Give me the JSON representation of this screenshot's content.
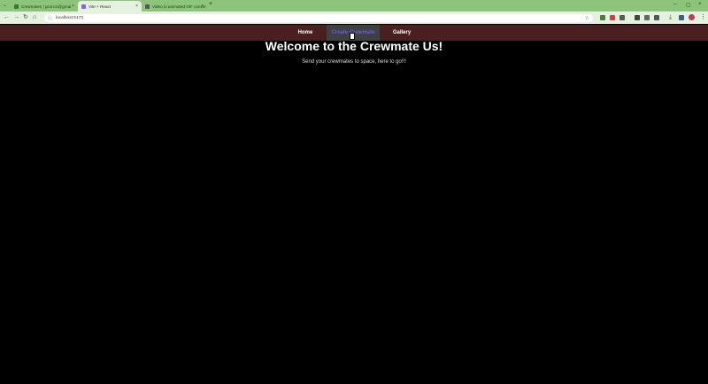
{
  "browser": {
    "tabs": [
      {
        "title": "Crewmates | gcsrcct@gmai",
        "favicon_color": "#2f7d32"
      },
      {
        "title": "Vite + React",
        "favicon_color": "#8b5cf6"
      },
      {
        "title": "Video to animated GIF conver",
        "favicon_color": "#555555"
      }
    ],
    "new_tab": "+",
    "url": "localhost:5173"
  },
  "app": {
    "nav": [
      "Home",
      "Create Crewmate",
      "Gallery"
    ],
    "heading": "Welcome to the Crewmate Us!",
    "subheading": "Send your crewmates to space, here to go!!!"
  }
}
